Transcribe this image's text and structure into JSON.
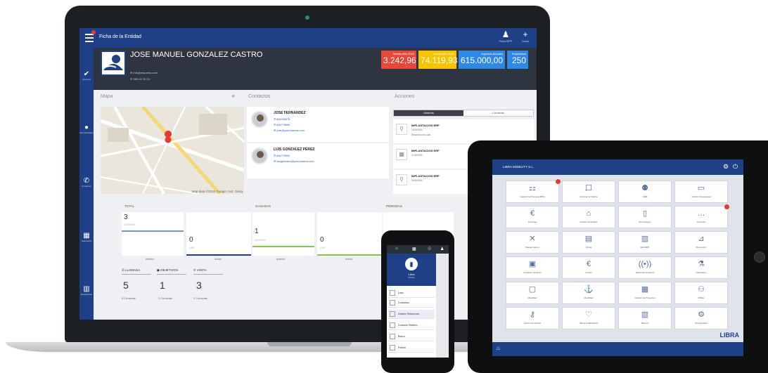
{
  "laptop": {
    "topbar": {
      "title": "Ficha de la Entidad",
      "btn1_label": "Ficha BPF",
      "btn2_label": "Crear"
    },
    "entity": {
      "name": "JOSE MANUEL GONZALEZ CASTRO",
      "email": "info@mipuedo.com",
      "phone": "985 62 23 24"
    },
    "kpis": [
      {
        "label": "Ventas Año 2015",
        "value": "3.242,96",
        "color": "#e8483b"
      },
      {
        "label": "Ventas Año 2016",
        "value": "74.119,93",
        "color": "#f6c500"
      },
      {
        "label": "Ingresos Anuales",
        "value": "615.000,00",
        "color": "#2f88e6"
      },
      {
        "label": "Empleados",
        "value": "250",
        "color": "#2f88e6"
      }
    ],
    "panels": {
      "map": "Mapa",
      "contacts": "Contactos",
      "actions": "Acciones"
    },
    "map_credit": "Map data ©2016 Google, Inst. Geog",
    "contacts": [
      {
        "name": "JOSE FERNANDEZ",
        "line1": "666345678",
        "line2": "666778899",
        "line3": "jose@puertoarena.com"
      },
      {
        "name": "LUIS GONZALEZ PEREZ",
        "line1": "666779900",
        "line2": "luisgonzalez@puertoarena.com"
      }
    ],
    "action_tabs": {
      "open": "Abiertas",
      "closed": "Cerradas"
    },
    "actions": [
      {
        "title": "IMPLANTACION ERP",
        "date": "15/3/2016",
        "desc": "Reunión con Luis"
      },
      {
        "title": "IMPLANTACION ERP",
        "date": "21/3/2016",
        "desc": ""
      },
      {
        "title": "IMPLANTACION ERP",
        "date": "23/3/2016",
        "desc": ""
      }
    ],
    "stats": [
      {
        "title": "TOTAL",
        "left_value": "3",
        "left_sub": "10.000,00",
        "right_value": "0",
        "right_sub": "0,00",
        "foot_left": "Anterior",
        "foot_right": "Actual"
      },
      {
        "title": "GANADAS",
        "left_value": "1",
        "left_sub": "10.000,00",
        "right_value": "0",
        "right_sub": "0,00",
        "foot_left": "Anterior",
        "foot_right": "Actual"
      },
      {
        "title": "PERDIDAS",
        "left_value": "0",
        "left_sub": "",
        "right_value": "0",
        "right_sub": "0,00",
        "foot_left": "",
        "foot_right": ""
      }
    ],
    "activity": [
      {
        "label": "LLAMADA",
        "icon": "✆",
        "value": "5",
        "sub": "5 Cerradas"
      },
      {
        "label": "OBJETIVOS",
        "icon": "◼",
        "value": "1",
        "sub": "1 Cerradas"
      },
      {
        "label": "VISITA",
        "icon": "⚲",
        "value": "3",
        "sub": "2 Cerradas"
      }
    ],
    "sidebar": [
      {
        "icon": "✔",
        "label": "Acciones"
      },
      {
        "icon": "●",
        "label": "Oportunidades"
      },
      {
        "icon": "✆",
        "label": "Contactos"
      },
      {
        "icon": "▦",
        "label": "Calendario"
      },
      {
        "icon": "▥",
        "label": "Estadísticas"
      }
    ]
  },
  "phone": {
    "hero_title": "Libra",
    "hero_sub": "Mobile",
    "rows": [
      "Lista",
      "Contactos",
      "Gestión Relaciones",
      "Contacto Relativo",
      "Banco",
      "Pedido"
    ]
  },
  "tablet": {
    "brand": "LIBRA",
    "title": "LIBRA MOBILITY S.L.",
    "logo": "LIBRA",
    "tiles": [
      {
        "label": "Gestión de Procesos BPM",
        "icon": "⚏",
        "badge": true
      },
      {
        "label": "Atención al Cliente",
        "icon": "☐",
        "badge": false
      },
      {
        "label": "CRM",
        "icon": "⚉",
        "badge": false
      },
      {
        "label": "Gestión Documental",
        "icon": "▭",
        "badge": false
      },
      {
        "label": "Finanzas",
        "icon": "€",
        "badge": false
      },
      {
        "label": "Gestión Inmuebles",
        "icon": "⌂",
        "badge": false
      },
      {
        "label": "Proveedores",
        "icon": "▯",
        "badge": false
      },
      {
        "label": "Servicios",
        "icon": "…",
        "badge": true
      },
      {
        "label": "Mantenimiento",
        "icon": "✕",
        "badge": false
      },
      {
        "label": "Obras",
        "icon": "▤",
        "badge": false
      },
      {
        "label": "Web BPF",
        "icon": "▥",
        "badge": false
      },
      {
        "label": "Producción",
        "icon": "⊿",
        "badge": false
      },
      {
        "label": "Logística / Almacén",
        "icon": "▣",
        "badge": false
      },
      {
        "label": "Ventas",
        "icon": "€",
        "badge": false
      },
      {
        "label": "Rastreo/Inventarios",
        "icon": "((•))",
        "badge": false
      },
      {
        "label": "Laboratorio",
        "icon": "⚗",
        "badge": false
      },
      {
        "label": "Movilidad",
        "icon": "▢",
        "badge": false
      },
      {
        "label": "Movilidad",
        "icon": "⚓",
        "badge": false
      },
      {
        "label": "Gestión de Proyectos",
        "icon": "▦",
        "badge": false
      },
      {
        "label": "RRHH",
        "icon": "⚇",
        "badge": false
      },
      {
        "label": "Control de Acceso",
        "icon": "⚷",
        "badge": false
      },
      {
        "label": "Marca Colaborativa",
        "icon": "♡",
        "badge": false
      },
      {
        "label": "Bancos",
        "icon": "▥",
        "badge": false
      },
      {
        "label": "Configuración",
        "icon": "⚙",
        "badge": false
      }
    ]
  }
}
